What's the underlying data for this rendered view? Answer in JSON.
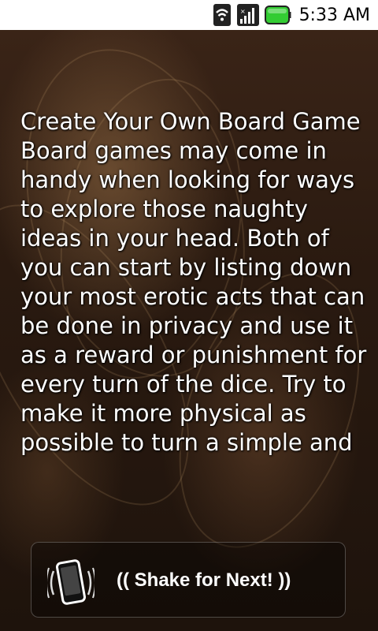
{
  "status_bar": {
    "time": "5:33 AM",
    "icons": [
      "wifi-icon",
      "signal-icon",
      "battery-icon"
    ],
    "battery_color": "#33cc33"
  },
  "article": {
    "text": "Create Your Own Board Game\nBoard games may come in handy when looking for ways to explore those naughty ideas in your head. Both of you can start by listing down your most erotic acts that can be done in privacy and use it as a reward or punishment for every turn of the dice. Try to make it more physical as possible to turn a simple and"
  },
  "shake_button": {
    "label": "(( Shake for Next! ))",
    "icon": "shake-phone-icon"
  }
}
